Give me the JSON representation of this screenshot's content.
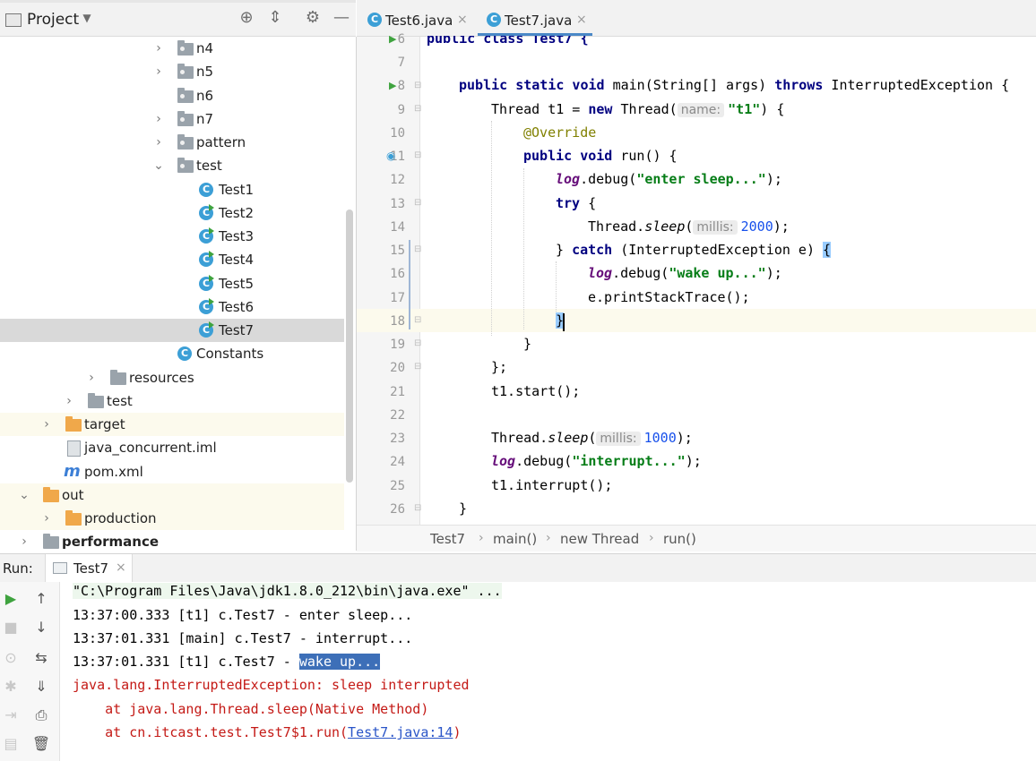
{
  "project_panel": {
    "title": "Project",
    "tree": [
      {
        "label": "n4",
        "kind": "pkg",
        "arrow": "›"
      },
      {
        "label": "n5",
        "kind": "pkg",
        "arrow": "›"
      },
      {
        "label": "n6",
        "kind": "pkg",
        "arrow": ""
      },
      {
        "label": "n7",
        "kind": "pkg",
        "arrow": "›"
      },
      {
        "label": "pattern",
        "kind": "pkg",
        "arrow": "›"
      },
      {
        "label": "test",
        "kind": "pkg",
        "arrow": "⌄"
      },
      {
        "label": "Test1",
        "kind": "class"
      },
      {
        "label": "Test2",
        "kind": "runclass"
      },
      {
        "label": "Test3",
        "kind": "runclass"
      },
      {
        "label": "Test4",
        "kind": "runclass"
      },
      {
        "label": "Test5",
        "kind": "runclass"
      },
      {
        "label": "Test6",
        "kind": "runclass"
      },
      {
        "label": "Test7",
        "kind": "runclass"
      },
      {
        "label": "Constants",
        "kind": "class"
      },
      {
        "label": "resources",
        "kind": "folder",
        "arrow": "›"
      },
      {
        "label": "test",
        "kind": "folder",
        "arrow": "›"
      },
      {
        "label": "target",
        "kind": "ofolder",
        "arrow": "›"
      },
      {
        "label": "java_concurrent.iml",
        "kind": "file"
      },
      {
        "label": "pom.xml",
        "kind": "maven"
      },
      {
        "label": "out",
        "kind": "ofolder",
        "arrow": "⌄"
      },
      {
        "label": "production",
        "kind": "ofolder",
        "arrow": "›"
      },
      {
        "label": "performance",
        "kind": "module",
        "arrow": "›"
      }
    ]
  },
  "tabs": [
    {
      "label": "Test6.java",
      "close": "×"
    },
    {
      "label": "Test7.java",
      "close": "×"
    }
  ],
  "editor": {
    "line_numbers": [
      "6",
      "7",
      "8",
      "9",
      "10",
      "11",
      "12",
      "13",
      "14",
      "15",
      "16",
      "17",
      "18",
      "19",
      "20",
      "21",
      "22",
      "23",
      "24",
      "25",
      "26"
    ],
    "code": {
      "l6": "public class Test7 {",
      "l8a": "public static void",
      "l8b": " main(String[] args) ",
      "l8c": "throws",
      "l8d": " InterruptedException {",
      "l9a": "Thread t1 = ",
      "l9b": "new",
      "l9c": " Thread(",
      "l9hint": "name:",
      "l9d": "\"t1\"",
      "l9e": ") {",
      "l10": "@Override",
      "l11a": "public void",
      "l11b": " run() {",
      "l12a": "log",
      "l12b": ".debug(",
      "l12c": "\"enter sleep...\"",
      "l12d": ");",
      "l13a": "try",
      "l13b": " {",
      "l14a": "Thread.",
      "l14b": "sleep",
      "l14c": "(",
      "l14hint": "millis:",
      "l14d": "2000",
      "l14e": ");",
      "l15a": "} ",
      "l15b": "catch",
      "l15c": " (InterruptedException e) ",
      "l15d": "{",
      "l16a": "log",
      "l16b": ".debug(",
      "l16c": "\"wake up...\"",
      "l16d": ");",
      "l17": "e.printStackTrace();",
      "l18": "}",
      "l19": "}",
      "l20": "};",
      "l21": "t1.start();",
      "l23a": "Thread.",
      "l23b": "sleep",
      "l23c": "(",
      "l23hint": "millis:",
      "l23d": "1000",
      "l23e": ");",
      "l24a": "log",
      "l24b": ".debug(",
      "l24c": "\"interrupt...\"",
      "l24d": ");",
      "l25": "t1.interrupt();",
      "l26": "}"
    }
  },
  "breadcrumb": [
    "Test7",
    "main()",
    "new Thread",
    "run()"
  ],
  "breadcrumb_sep": "›",
  "run_panel": {
    "label": "Run:",
    "tab": "Test7",
    "tab_close": "×",
    "console": {
      "cmd": "\"C:\\Program Files\\Java\\jdk1.8.0_212\\bin\\java.exe\" ...",
      "line1": "13:37:00.333 [t1] c.Test7 - enter sleep...",
      "line2": "13:37:01.331 [main] c.Test7 - interrupt...",
      "line3a": "13:37:01.331 [t1] c.Test7 - ",
      "line3b": "wake up...",
      "err1": "java.lang.InterruptedException: sleep interrupted",
      "err2": "    at java.lang.Thread.sleep(Native Method)",
      "err3a": "    at cn.itcast.test.Test7$1.run(",
      "err3link": "Test7.java:14",
      "err3b": ")"
    }
  }
}
